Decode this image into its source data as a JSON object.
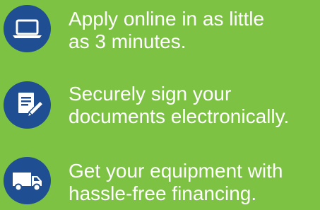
{
  "colors": {
    "background": "#7dc242",
    "icon_circle": "#1f4e93",
    "text": "#ffffff"
  },
  "steps": [
    {
      "icon": "laptop-icon",
      "lines": [
        "Apply online in as little",
        "as 3 minutes."
      ]
    },
    {
      "icon": "document-pen-icon",
      "lines": [
        "Securely sign your",
        "documents electronically."
      ]
    },
    {
      "icon": "delivery-truck-icon",
      "lines": [
        "Get your equipment with",
        "hassle-free financing."
      ]
    }
  ]
}
